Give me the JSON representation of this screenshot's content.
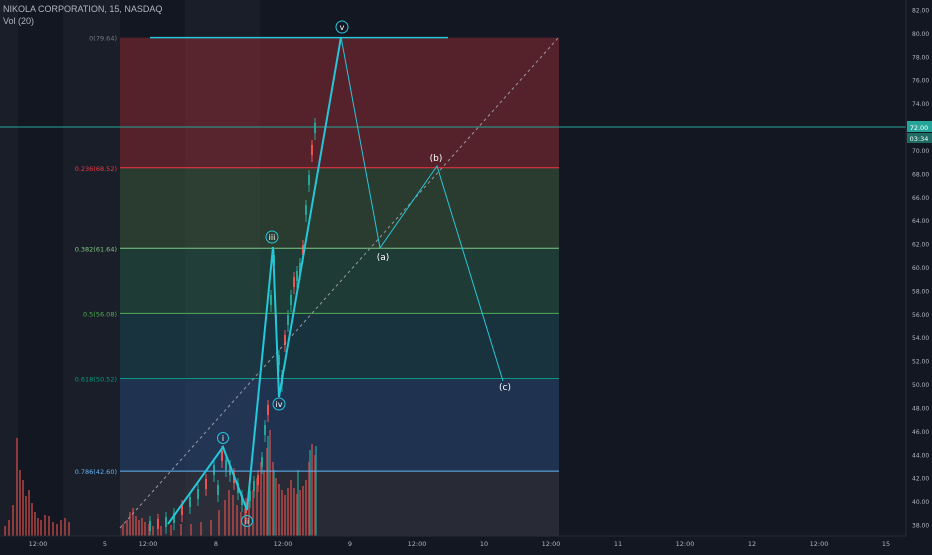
{
  "header": {
    "symbol_line": "NIKOLA CORPORATION, 15, NASDAQ",
    "volume_label": "Vol (20)"
  },
  "price_axis": {
    "ticks": [
      "82.00",
      "80.00",
      "78.00",
      "76.00",
      "74.00",
      "72.00",
      "70.00",
      "68.00",
      "66.00",
      "64.00",
      "62.00",
      "60.00",
      "58.00",
      "56.00",
      "54.00",
      "52.00",
      "50.00",
      "48.00",
      "46.00",
      "44.00",
      "42.00",
      "40.00",
      "38.00"
    ],
    "current_price": "72.00",
    "countdown": "03:34",
    "current_price_color": "#26a69a"
  },
  "time_axis": {
    "labels": [
      "12:00",
      "5",
      "12:00",
      "8",
      "12:00",
      "9",
      "12:00",
      "10",
      "12:00",
      "11",
      "12:00",
      "12",
      "12:00",
      "15"
    ]
  },
  "fib": {
    "levels": [
      {
        "label": "0(79.64)",
        "price": 79.64,
        "color": "#787b86"
      },
      {
        "label": "0.236(68.52)",
        "price": 68.52,
        "color": "#f23645"
      },
      {
        "label": "0.382(61.64)",
        "price": 61.64,
        "color": "#81c784"
      },
      {
        "label": "0.5(56.08)",
        "price": 56.08,
        "color": "#4caf50"
      },
      {
        "label": "0.618(50.52)",
        "price": 50.52,
        "color": "#089981"
      },
      {
        "label": "0.786(42.60)",
        "price": 42.6,
        "color": "#64b5f6"
      }
    ],
    "zone_colors": [
      "#8c2b33",
      "#3e5a3a",
      "#2a5a45",
      "#1e4a55",
      "#294a78",
      "#3a3d45"
    ]
  },
  "waves": {
    "labels": [
      "i",
      "ii",
      "iii",
      "iv",
      "v"
    ],
    "corrective_labels": [
      "(a)",
      "(b)",
      "(c)"
    ],
    "line_color": "#26c6da"
  }
}
